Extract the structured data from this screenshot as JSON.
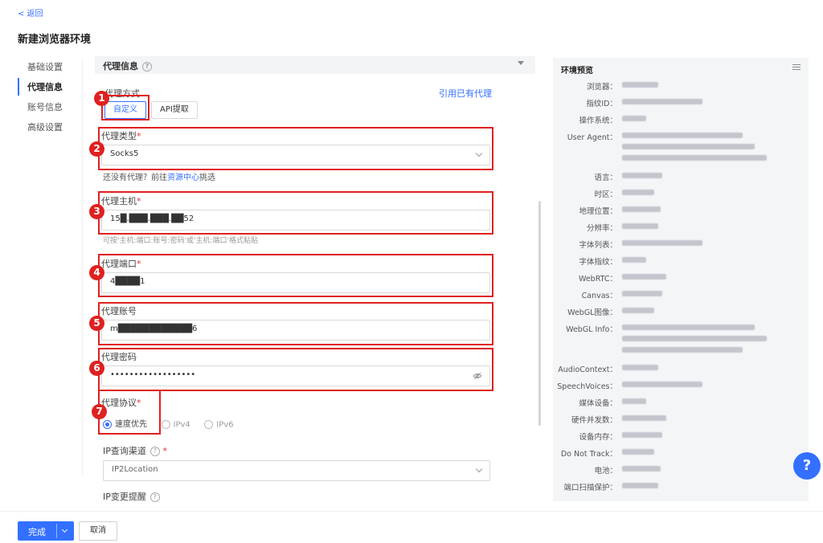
{
  "header": {
    "back_label": "< 返回",
    "title": "新建浏览器环境"
  },
  "nav": {
    "items": [
      {
        "label": "基础设置",
        "active": false
      },
      {
        "label": "代理信息",
        "active": true
      },
      {
        "label": "账号信息",
        "active": false
      },
      {
        "label": "高级设置",
        "active": false
      }
    ]
  },
  "section": {
    "title": "代理信息"
  },
  "proxy_mode": {
    "label": "代理方式",
    "use_existing_link": "引用已有代理",
    "options": [
      "自定义",
      "API提取"
    ],
    "selected": "自定义"
  },
  "proxy_type": {
    "label": "代理类型",
    "required": "*",
    "value": "Socks5",
    "hint_prefix": "还没有代理？前往",
    "hint_link": "资源中心",
    "hint_suffix": "挑选"
  },
  "proxy_host": {
    "label": "代理主机",
    "required": "*",
    "value": "15█.███.███.██52",
    "hint": "可按'主机:端口:账号:密码'或'主机:端口'格式粘贴"
  },
  "proxy_port": {
    "label": "代理端口",
    "required": "*",
    "value": "4████1"
  },
  "proxy_account": {
    "label": "代理账号",
    "value": "m████████████6"
  },
  "proxy_password": {
    "label": "代理密码",
    "value": "••••••••••••••••••"
  },
  "proxy_protocol": {
    "label": "代理协议",
    "required": "*",
    "options": [
      "速度优先",
      "IPv4",
      "IPv6"
    ],
    "selected": "速度优先"
  },
  "ip_channel": {
    "label": "IP查询渠道",
    "required": "*",
    "value": "IP2Location"
  },
  "ip_change": {
    "label": "IP变更提醒"
  },
  "badges": [
    "1",
    "2",
    "3",
    "4",
    "5",
    "6",
    "7"
  ],
  "preview": {
    "title": "环境预览",
    "rows": [
      {
        "key": "浏览器：",
        "blurs": [
          1
        ]
      },
      {
        "key": "指纹ID：",
        "blurs": [
          1
        ]
      },
      {
        "key": "操作系统：",
        "blurs": [
          1
        ]
      },
      {
        "key": "User Agent：",
        "blurs": [
          3
        ]
      },
      {
        "key": "语言：",
        "blurs": [
          1
        ]
      },
      {
        "key": "时区：",
        "blurs": [
          1
        ]
      },
      {
        "key": "地理位置：",
        "blurs": [
          1
        ]
      },
      {
        "key": "分辨率：",
        "blurs": [
          1
        ]
      },
      {
        "key": "字体列表：",
        "blurs": [
          1
        ]
      },
      {
        "key": "字体指纹：",
        "blurs": [
          1
        ]
      },
      {
        "key": "WebRTC：",
        "blurs": [
          1
        ]
      },
      {
        "key": "Canvas：",
        "blurs": [
          1
        ]
      },
      {
        "key": "WebGL图像：",
        "blurs": [
          1
        ]
      },
      {
        "key": "WebGL Info：",
        "blurs": [
          3
        ]
      },
      {
        "key": "AudioContext：",
        "blurs": [
          1
        ]
      },
      {
        "key": "SpeechVoices：",
        "blurs": [
          1
        ]
      },
      {
        "key": "媒体设备：",
        "blurs": [
          1
        ]
      },
      {
        "key": "硬件并发数：",
        "blurs": [
          1
        ]
      },
      {
        "key": "设备内存：",
        "blurs": [
          1
        ]
      },
      {
        "key": "Do Not Track：",
        "blurs": [
          1
        ]
      },
      {
        "key": "电池：",
        "blurs": [
          1
        ]
      },
      {
        "key": "端口扫描保护：",
        "blurs": [
          1
        ]
      }
    ]
  },
  "help_fab": {
    "label": "?"
  },
  "footer": {
    "done_label": "完成",
    "cancel_label": "取消"
  },
  "colors": {
    "accent": "#3370ff",
    "annotation_red": "#e02020",
    "required": "#e03030"
  }
}
